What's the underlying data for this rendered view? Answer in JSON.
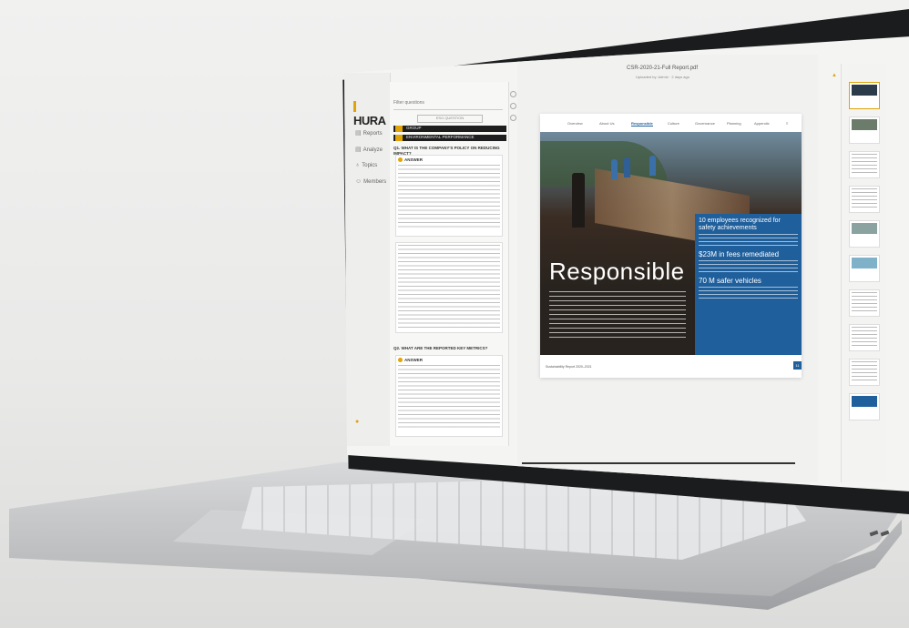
{
  "app": {
    "brand": "HURA"
  },
  "nav": {
    "items": [
      {
        "icon": "document-icon",
        "label": "Reports"
      },
      {
        "icon": "document-icon",
        "label": "Analyze"
      },
      {
        "icon": "lightbulb-icon",
        "label": "Topics"
      },
      {
        "icon": "user-icon",
        "label": "Members"
      }
    ]
  },
  "questions": {
    "search_placeholder": "Filter questions",
    "selector": "ESG QUESTION",
    "group_rows": [
      {
        "label": "GROUP"
      },
      {
        "label": "ENVIRONMENTAL PERFORMANCE"
      }
    ],
    "items": [
      {
        "title": "Q1. WHAT IS THE COMPANY'S POLICY ON REDUCING IMPACT?",
        "answer_label": "ANSWER"
      },
      {
        "title": "Q2. WHAT ARE THE REPORTED KEY METRICS?",
        "answer_label": "ANSWER"
      }
    ]
  },
  "document": {
    "title": "CSR-2020-21-Full Report.pdf",
    "subtitle": "Uploaded by: Admin · 2 days ago",
    "tabs": [
      "Overview",
      "About Us",
      "Responsible",
      "Culture",
      "Governance",
      "Planning",
      "Appendix"
    ],
    "active_tab": "Responsible",
    "headline": "Responsible",
    "stats": [
      "10 employees recognized for safety achievements",
      "$23M in fees remediated",
      "70 M safer vehicles"
    ],
    "footer": "Sustainability Report 2020–2021",
    "page_number": "11"
  },
  "thumbnails": {
    "count": 10,
    "selected_index": 0
  },
  "colors": {
    "accent": "#e0a40a",
    "brand_blue": "#1f5f9c",
    "dark": "#1e1e1e"
  }
}
